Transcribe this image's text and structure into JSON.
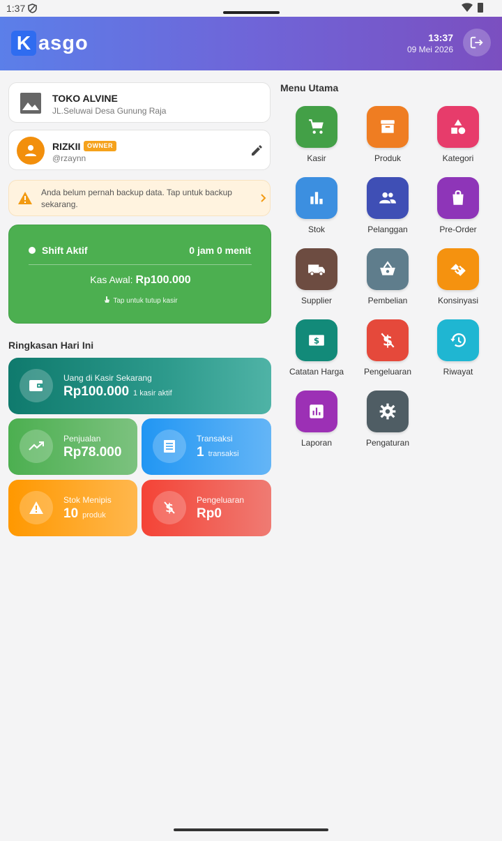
{
  "status_bar": {
    "time": "1:37"
  },
  "header": {
    "logo_letter": "K",
    "logo_rest": "asgo",
    "clock": "13:37",
    "date": "09 Mei 2026"
  },
  "store": {
    "name": "TOKO ALVINE",
    "address": "JL.Seluwai Desa Gunung Raja"
  },
  "user": {
    "name": "RIZKII",
    "role_badge": "OWNER",
    "handle": "@rzaynn"
  },
  "backup_warning": {
    "text": "Anda belum pernah backup data. Tap untuk backup sekarang."
  },
  "shift": {
    "label": "Shift Aktif",
    "duration": "0 jam 0 menit",
    "kas_awal_label": "Kas Awal:",
    "kas_awal_value": "Rp100.000",
    "tap_hint": "Tap untuk tutup kasir"
  },
  "summary": {
    "title": "Ringkasan Hari Ini",
    "cash": {
      "label": "Uang di Kasir Sekarang",
      "value": "Rp100.000",
      "sub": "1 kasir aktif"
    },
    "sales": {
      "label": "Penjualan",
      "value": "Rp78.000"
    },
    "transactions": {
      "label": "Transaksi",
      "value": "1",
      "sub": "transaksi"
    },
    "low_stock": {
      "label": "Stok Menipis",
      "value": "10",
      "sub": "produk"
    },
    "expenses": {
      "label": "Pengeluaran",
      "value": "Rp0"
    }
  },
  "menu": {
    "title": "Menu Utama",
    "items": [
      {
        "label": "Kasir",
        "icon": "cart-icon",
        "color": "#43a047"
      },
      {
        "label": "Produk",
        "icon": "archive-icon",
        "color": "#ef7d22"
      },
      {
        "label": "Kategori",
        "icon": "category-icon",
        "color": "#e73c6b"
      },
      {
        "label": "Stok",
        "icon": "bar-chart-icon",
        "color": "#3c8fe0"
      },
      {
        "label": "Pelanggan",
        "icon": "people-icon",
        "color": "#3f4fb5"
      },
      {
        "label": "Pre-Order",
        "icon": "shopping-bag-icon",
        "color": "#8e35b8"
      },
      {
        "label": "Supplier",
        "icon": "truck-icon",
        "color": "#6d4c41"
      },
      {
        "label": "Pembelian",
        "icon": "basket-icon",
        "color": "#5f7d8c"
      },
      {
        "label": "Konsinyasi",
        "icon": "handshake-icon",
        "color": "#f5920f"
      },
      {
        "label": "Catatan Harga",
        "icon": "price-tag-icon",
        "color": "#128a79"
      },
      {
        "label": "Pengeluaran",
        "icon": "money-off-icon",
        "color": "#e5493b"
      },
      {
        "label": "Riwayat",
        "icon": "history-icon",
        "color": "#1fb6d2"
      },
      {
        "label": "Laporan",
        "icon": "report-icon",
        "color": "#9c30b5"
      },
      {
        "label": "Pengaturan",
        "icon": "gear-icon",
        "color": "#4f5d64"
      }
    ]
  }
}
